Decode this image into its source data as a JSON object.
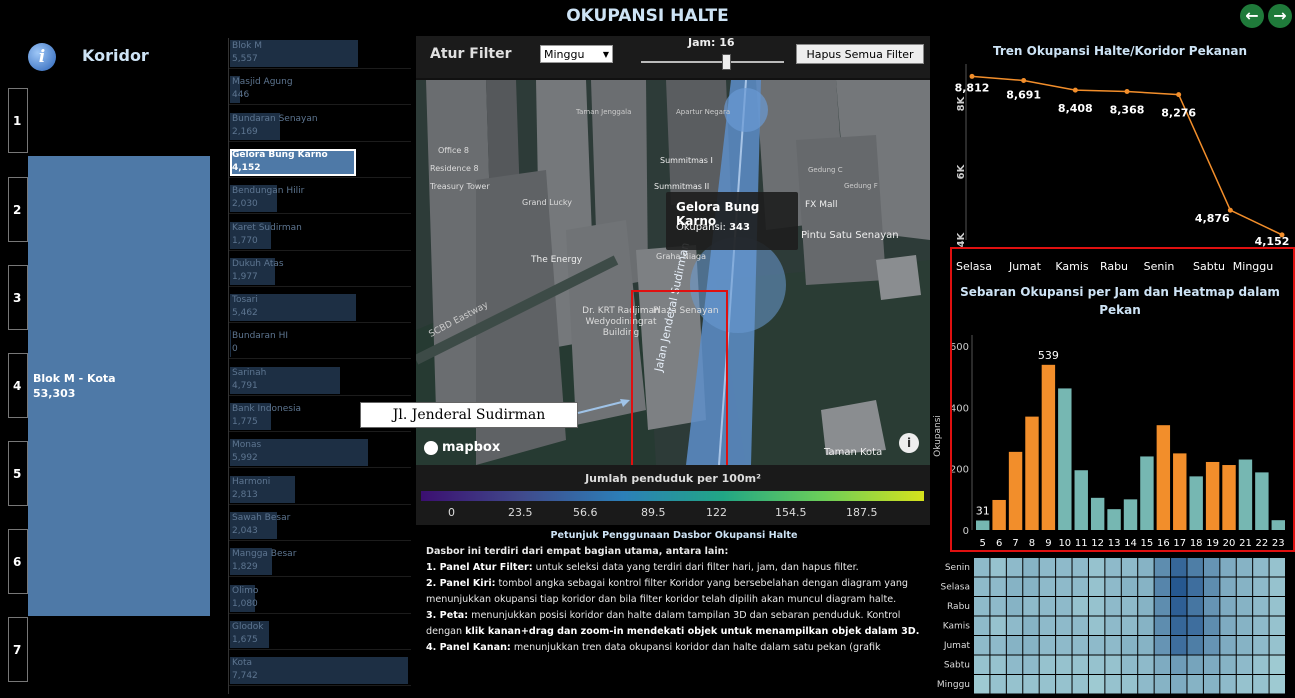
{
  "header": {
    "title": "OKUPANSI HALTE",
    "nav_prev_icon": "arrow-left-circle-icon",
    "nav_next_icon": "arrow-right-circle-icon",
    "nav_prev_glyph": "←",
    "nav_next_glyph": "→"
  },
  "left_panel": {
    "info_glyph": "i",
    "title": "Koridor",
    "corridor_buttons": [
      "1",
      "2",
      "3",
      "4",
      "5",
      "6",
      "7"
    ],
    "selected_corridor": {
      "name": "Blok M - Kota",
      "value": "53,303"
    },
    "bar_color": "#4e79a7"
  },
  "halte_list": [
    {
      "name": "Blok M",
      "value": "5,557",
      "num": 5557
    },
    {
      "name": "Masjid Agung",
      "value": "446",
      "num": 446
    },
    {
      "name": "Bundaran Senayan",
      "value": "2,169",
      "num": 2169
    },
    {
      "name": "Gelora Bung Karno",
      "value": "4,152",
      "num": 4152,
      "selected": true
    },
    {
      "name": "Bendungan Hilir",
      "value": "2,030",
      "num": 2030
    },
    {
      "name": "Karet Sudirman",
      "value": "1,770",
      "num": 1770
    },
    {
      "name": "Dukuh Atas",
      "value": "1,977",
      "num": 1977
    },
    {
      "name": "Tosari",
      "value": "5,462",
      "num": 5462
    },
    {
      "name": "Bundaran HI",
      "value": "0",
      "num": 0
    },
    {
      "name": "Sarinah",
      "value": "4,791",
      "num": 4791
    },
    {
      "name": "Bank Indonesia",
      "value": "1,775",
      "num": 1775
    },
    {
      "name": "Monas",
      "value": "5,992",
      "num": 5992
    },
    {
      "name": "Harmoni",
      "value": "2,813",
      "num": 2813
    },
    {
      "name": "Sawah Besar",
      "value": "2,043",
      "num": 2043
    },
    {
      "name": "Mangga Besar",
      "value": "1,829",
      "num": 1829
    },
    {
      "name": "Olimo",
      "value": "1,080",
      "num": 1080
    },
    {
      "name": "Glodok",
      "value": "1,675",
      "num": 1675
    },
    {
      "name": "Kota",
      "value": "7,742",
      "num": 7742
    }
  ],
  "filter": {
    "label": "Atur Filter",
    "day_selected": "Minggu",
    "jam_label": "Jam: 16",
    "jam_value": 16,
    "clear_button": "Hapus Semua Filter"
  },
  "map": {
    "labels": [
      "Taman Jenggala",
      "Apartur Negara",
      "Plaza Senayan",
      "Office 8",
      "Residence 8",
      "Treasury Tower",
      "Grand Lucky",
      "Summitmas I",
      "Summitmas II",
      "FX Mall",
      "Gedung C",
      "Gedung F",
      "Pintu Satu Senayan",
      "The Energy",
      "Graha Niaga",
      "Dr. KRT Radjiman Wedyodiningrat Building",
      "Taman Kota",
      "SCBD Eastway",
      "Jalan Jenderal Sudirman"
    ],
    "tooltip_title": "Gelora Bung Karno",
    "tooltip_label": "Okupansi:",
    "tooltip_value": "343",
    "logo": "mapbox",
    "info_glyph": "i",
    "callout": "Jl. Jenderal Sudirman",
    "legend_title": "Jumlah penduduk per 100m²",
    "legend_ticks": [
      "0",
      "23.5",
      "56.6",
      "89.5",
      "122",
      "154.5",
      "187.5"
    ]
  },
  "instructions": {
    "title": "Petunjuk Penggunaan Dasbor Okupansi Halte",
    "intro": "Dasbor ini terdiri dari empat bagian utama, antara lain:",
    "items": [
      {
        "label": "1. Panel Atur Filter:",
        "text": " untuk seleksi data yang terdiri dari filter hari, jam, dan hapus filter."
      },
      {
        "label": "2. Panel Kiri:",
        "text": " tombol angka sebagai kontrol filter Koridor yang bersebelahan dengan diagram yang menunjukkan okupansi tiap koridor dan bila filter koridor telah dipilih akan muncul diagram halte."
      },
      {
        "label": "3. Peta:",
        "text": " menunjukkan posisi koridor dan halte dalam tampilan 3D dan sebaran penduduk. Kontrol dengan "
      },
      {
        "label": "4. Panel Kanan:",
        "text": " menunjukkan tren data okupansi koridor dan halte dalam satu pekan (grafik"
      }
    ],
    "item3_bold": "klik kanan+drag dan zoom-in mendekati objek untuk menampilkan objek dalam 3D."
  },
  "chart_data": [
    {
      "type": "line",
      "title": "Tren Okupansi Halte/Koridor Pekanan",
      "categories": [
        "Selasa",
        "Jumat",
        "Kamis",
        "Rabu",
        "Senin",
        "Sabtu",
        "Minggu"
      ],
      "values": [
        8812,
        8691,
        8408,
        8368,
        8276,
        4876,
        4152
      ],
      "labels": [
        "8,812",
        "8,691",
        "8,408",
        "8,368",
        "8,276",
        "4,876",
        "4,152"
      ],
      "y_ticks": [
        "8K",
        "6K",
        "4K"
      ],
      "ylim": [
        4000,
        9000
      ],
      "color": "#f28e2b"
    },
    {
      "type": "bar",
      "title": "Sebaran Okupansi per Jam dan Heatmap dalam Pekan",
      "ylabel": "Okupansi",
      "categories": [
        "5",
        "6",
        "7",
        "8",
        "9",
        "10",
        "11",
        "12",
        "13",
        "14",
        "15",
        "16",
        "17",
        "18",
        "19",
        "20",
        "21",
        "22",
        "23"
      ],
      "values": [
        31,
        98,
        255,
        370,
        539,
        462,
        195,
        105,
        68,
        100,
        240,
        342,
        250,
        175,
        222,
        212,
        230,
        188,
        32
      ],
      "highlighted": [
        false,
        true,
        true,
        true,
        true,
        false,
        false,
        false,
        false,
        false,
        false,
        true,
        true,
        false,
        true,
        true,
        false,
        false,
        false
      ],
      "data_labels": {
        "0": "31",
        "4": "539"
      },
      "y_ticks": [
        "0",
        "200",
        "400",
        "600"
      ],
      "ylim": [
        0,
        620
      ],
      "colors": {
        "highlight": "#f28e2b",
        "normal": "#76b7b2"
      }
    },
    {
      "type": "heatmap",
      "rows": [
        "Senin",
        "Selasa",
        "Rabu",
        "Kamis",
        "Jumat",
        "Sabtu",
        "Minggu"
      ],
      "columns": [
        "5",
        "6",
        "7",
        "8",
        "9",
        "10",
        "11",
        "12",
        "13",
        "14",
        "15",
        "16",
        "17",
        "18",
        "19",
        "20",
        "21",
        "22",
        "23"
      ],
      "values": [
        [
          0.3,
          0.25,
          0.3,
          0.35,
          0.3,
          0.3,
          0.3,
          0.25,
          0.3,
          0.3,
          0.35,
          0.6,
          0.85,
          0.7,
          0.55,
          0.4,
          0.35,
          0.3,
          0.25
        ],
        [
          0.3,
          0.3,
          0.35,
          0.35,
          0.3,
          0.3,
          0.3,
          0.25,
          0.3,
          0.35,
          0.35,
          0.65,
          0.95,
          0.8,
          0.6,
          0.4,
          0.35,
          0.3,
          0.25
        ],
        [
          0.3,
          0.3,
          0.35,
          0.3,
          0.3,
          0.3,
          0.25,
          0.25,
          0.3,
          0.3,
          0.35,
          0.6,
          0.9,
          0.75,
          0.55,
          0.4,
          0.35,
          0.3,
          0.25
        ],
        [
          0.3,
          0.25,
          0.3,
          0.35,
          0.3,
          0.3,
          0.3,
          0.25,
          0.3,
          0.3,
          0.35,
          0.6,
          0.85,
          0.8,
          0.6,
          0.4,
          0.35,
          0.3,
          0.25
        ],
        [
          0.3,
          0.3,
          0.35,
          0.35,
          0.3,
          0.3,
          0.3,
          0.3,
          0.3,
          0.35,
          0.35,
          0.55,
          0.8,
          0.7,
          0.55,
          0.4,
          0.35,
          0.3,
          0.25
        ],
        [
          0.25,
          0.25,
          0.3,
          0.3,
          0.25,
          0.25,
          0.25,
          0.25,
          0.25,
          0.3,
          0.3,
          0.4,
          0.5,
          0.45,
          0.4,
          0.35,
          0.3,
          0.25,
          0.2
        ],
        [
          0.2,
          0.25,
          0.25,
          0.25,
          0.25,
          0.25,
          0.25,
          0.2,
          0.25,
          0.25,
          0.3,
          0.35,
          0.4,
          0.35,
          0.35,
          0.3,
          0.25,
          0.25,
          0.2
        ]
      ]
    }
  ]
}
